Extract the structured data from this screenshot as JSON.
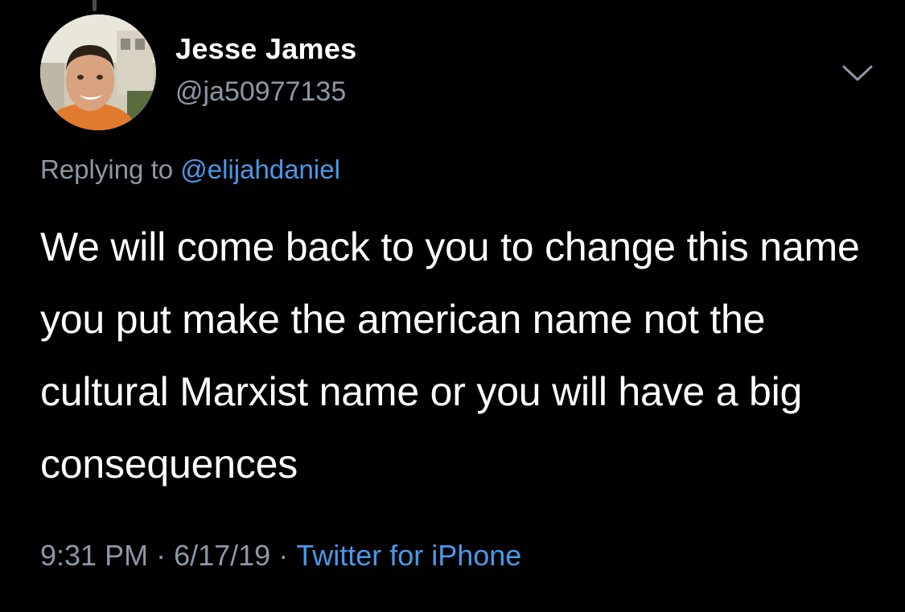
{
  "user": {
    "display_name": "Jesse James",
    "handle": "@ja50977135",
    "avatar_icon": "profile-photo"
  },
  "reply": {
    "prefix": "Replying to",
    "mention": "@elijahdaniel"
  },
  "tweet": {
    "text": "We will come back to you to change this name you put make the american name not the cultural Marxist name or you will have a big consequences"
  },
  "meta": {
    "time": "9:31 PM",
    "separator": "·",
    "date": "6/17/19",
    "source": "Twitter for iPhone"
  },
  "menu": {
    "icon": "chevron-down-icon"
  },
  "colors": {
    "background": "#000000",
    "primary_text": "#ffffff",
    "secondary_text": "#8b98a5",
    "link": "#4a99e9"
  }
}
